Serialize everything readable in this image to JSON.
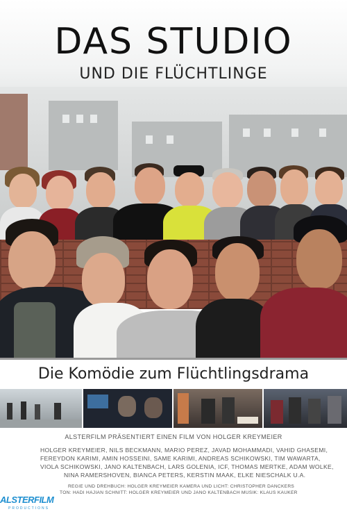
{
  "title": {
    "main": "DAS STUDIO",
    "sub": "UND DIE FLÜCHTLINGE"
  },
  "tagline": "Die Komödie zum Flüchtlingsdrama",
  "presents": "ALSTERFILM PRÄSENTIERT EINEN FILM VON HOLGER KREYMEIER",
  "cast_lines": [
    "HOLGER KREYMEIER, NILS BECKMANN, MARIO PEREZ, JAVAD MOHAMMADI, VAHID GHASEMI,",
    "FEREYDON KARIMI, AMIN HOSSEINI, SAME KARIMI, ANDREAS SCHIKOWSKI, TIM WAWARTA,",
    "VIOLA SCHIKOWSKI, JANO KALTENBACH, LARS GOLENIA, ICF, THOMAS MERTKE, ADAM WOLKE,",
    "NINA RAMERSHOVEN, BIANCA PETERS, KERSTIN MAAK, ELKE NIESCHALK U.A."
  ],
  "crew_lines": [
    "REGIE UND DREHBUCH: HOLGER KREYMEIER    KAMERA UND LICHT: CHRISTOPHER DANCKERS",
    "TON: HADI HAJIAN    SCHNITT: HOLGER KREYMEIER UND JANO KALTENBACH    MUSIK: KLAUS KAUKER"
  ],
  "logo": {
    "part1": "ALSTER",
    "part2": "FILM",
    "sub": "PRODUCTIONS"
  },
  "colors": {
    "logo_blue": "#1e8fd0",
    "brick": "#8a4a3a",
    "text_gray": "#555555"
  }
}
